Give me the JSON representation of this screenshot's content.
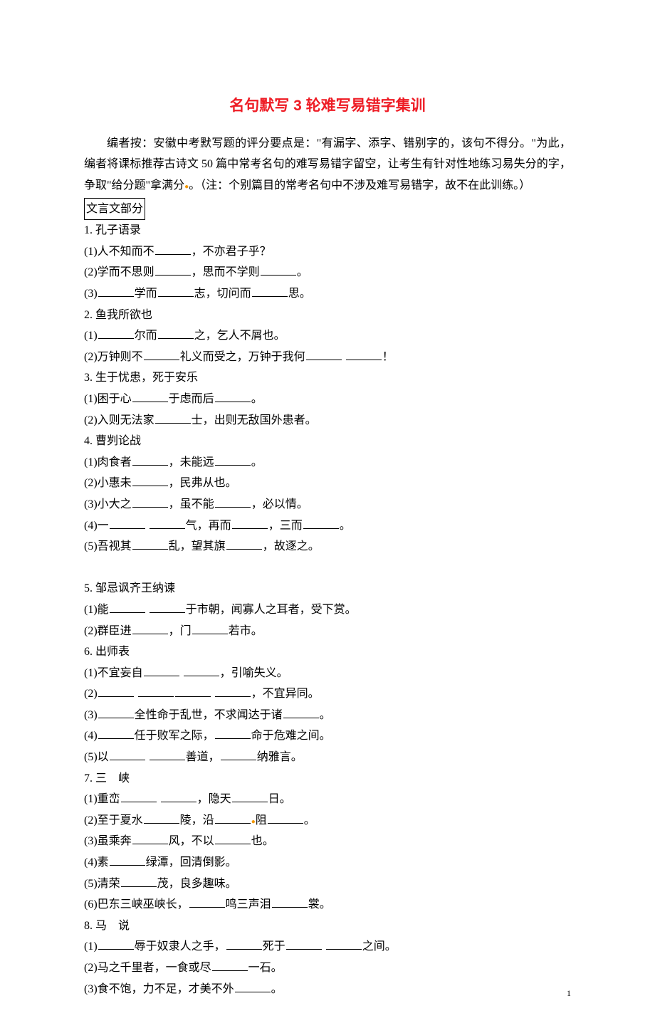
{
  "title": "名句默写 3 轮难写易错字集训",
  "intro": "编者按：安徽中考默写题的评分要点是：\"有漏字、添字、错别字的，该句不得分。\"为此，编者将课标推荐古诗文 50 篇中常考名句的难写易错字留空，让考生有针对性地练习易失分的字，争取\"给分题\"拿满分",
  "intro_note": "（注：个别篇目的常考名句中不涉及难写易错字，故不在此训练。）",
  "section_label": "文言文部分",
  "items": {
    "s1": {
      "title": "1. 孔子语录",
      "q1a": "(1)人不知而不",
      "q1b": "，不亦君子乎？",
      "q2a": "(2)学而不思则",
      "q2b": "，思而不学则",
      "q2c": "。",
      "q3a": "(3)",
      "q3b": "学而",
      "q3c": "志，切问而",
      "q3d": "思。"
    },
    "s2": {
      "title": "2. 鱼我所欲也",
      "q1a": "(1)",
      "q1b": "尔而",
      "q1c": "之，乞人不屑也。",
      "q2a": "(2)万钟则不",
      "q2b": "礼义而受之，万钟于我何",
      "q2c": "！"
    },
    "s3": {
      "title": "3. 生于忧患，死于安乐",
      "q1a": "(1)困于心",
      "q1b": "于虑而后",
      "q1c": "。",
      "q2a": "(2)入则无法家",
      "q2b": "士，出则无敌国外患者。"
    },
    "s4": {
      "title": "4. 曹刿论战",
      "q1a": "(1)肉食者",
      "q1b": "，未能远",
      "q1c": "。",
      "q2a": "(2)小惠未",
      "q2b": "，民弗从也。",
      "q3a": "(3)小大之",
      "q3b": "，虽不能",
      "q3c": "，必以情。",
      "q4a": "(4)一",
      "q4b": "气，再而",
      "q4c": "，三而",
      "q4d": "。",
      "q5a": "(5)吾视其",
      "q5b": "乱，望其旗",
      "q5c": "，故逐之。"
    },
    "s5": {
      "title": "5. 邹忌讽齐王纳谏",
      "q1a": "(1)能",
      "q1b": "于市朝，闻寡人之耳者，受下赏。",
      "q2a": "(2)群臣进",
      "q2b": "，门",
      "q2c": "若市。"
    },
    "s6": {
      "title": "6. 出师表",
      "q1a": "(1)不宜妄自",
      "q1b": "，引喻失义。",
      "q2a": "(2)",
      "q2b": "，不宜异同。",
      "q3a": "(3)",
      "q3b": "全性命于乱世，不求闻达于诸",
      "q3c": "。",
      "q4a": "(4)",
      "q4b": "任于败军之际，",
      "q4c": "命于危难之间。",
      "q5a": "(5)以",
      "q5b": "善道，",
      "q5c": "纳雅言。"
    },
    "s7": {
      "title": "7. 三　峡",
      "q1a": "(1)重峦",
      "q1b": "，隐天",
      "q1c": "日。",
      "q2a": "(2)至于夏水",
      "q2b": "陵，沿",
      "q2c": "阻",
      "q2d": "。",
      "q3a": "(3)虽乘奔",
      "q3b": "风，不以",
      "q3c": "也。",
      "q4a": "(4)素",
      "q4b": "绿潭，回清倒影。",
      "q5a": "(5)清荣",
      "q5b": "茂，良多趣味。",
      "q6a": "(6)巴东三峡巫峡长，",
      "q6b": "鸣三声泪",
      "q6c": "裳。"
    },
    "s8": {
      "title": "8. 马　说",
      "q1a": "(1)",
      "q1b": "辱于奴隶人之手，",
      "q1c": "死于",
      "q1d": "之间。",
      "q2a": "(2)马之千里者，一食或尽",
      "q2b": "一石。",
      "q3a": "(3)食不饱，力不足，才美不外",
      "q3b": "。"
    }
  },
  "page_number": "1"
}
